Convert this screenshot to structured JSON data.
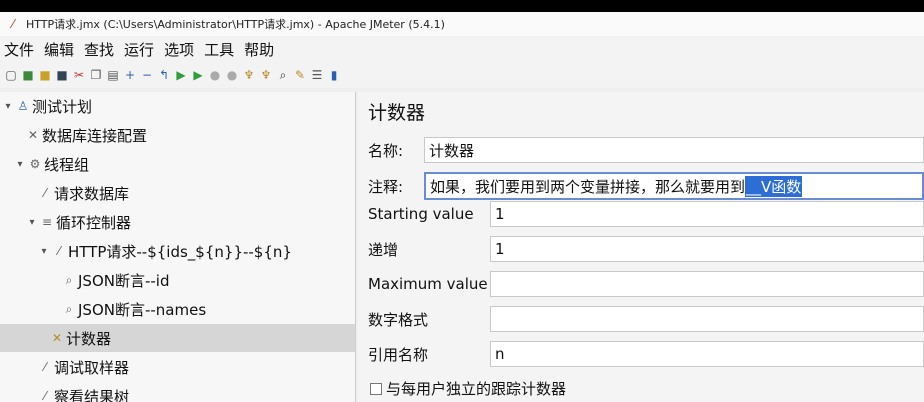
{
  "window": {
    "title": "HTTP请求.jmx (C:\\Users\\Administrator\\HTTP请求.jmx) - Apache JMeter (5.4.1)"
  },
  "menu": [
    "文件",
    "编辑",
    "查找",
    "运行",
    "选项",
    "工具",
    "帮助"
  ],
  "tree": [
    {
      "label": "测试计划",
      "icon": "flask-icon",
      "expander": "▾"
    },
    {
      "label": "数据库连接配置",
      "icon": "wrench-icon",
      "expander": ""
    },
    {
      "label": "线程组",
      "icon": "gear-icon",
      "expander": "▾"
    },
    {
      "label": "请求数据库",
      "icon": "pipette-icon",
      "expander": ""
    },
    {
      "label": "循环控制器",
      "icon": "loop-icon",
      "expander": "▾"
    },
    {
      "label": "HTTP请求--${ids_${n}}--${n}",
      "icon": "pipette-icon",
      "expander": "▾"
    },
    {
      "label": "JSON断言--id",
      "icon": "magnifier-icon",
      "expander": ""
    },
    {
      "label": "JSON断言--names",
      "icon": "magnifier-icon",
      "expander": ""
    },
    {
      "label": "计数器",
      "icon": "wrench-icon",
      "expander": ""
    },
    {
      "label": "调试取样器",
      "icon": "pipette-icon",
      "expander": ""
    },
    {
      "label": "察看结果树",
      "icon": "chart-icon",
      "expander": ""
    }
  ],
  "panel": {
    "title": "计数器",
    "name_label": "名称:",
    "name_value": "计数器",
    "comment_label": "注释:",
    "comment_text": "如果，我们要用到两个变量拼接，那么就要用到",
    "comment_selected": "__V函数",
    "starting_label": "Starting value",
    "starting_value": "1",
    "increment_label": "递增",
    "increment_value": "1",
    "max_label": "Maximum value",
    "max_value": "",
    "format_label": "数字格式",
    "format_value": "",
    "ref_label": "引用名称",
    "ref_value": "n",
    "track_label": "与每用户独立的跟踪计数器"
  }
}
